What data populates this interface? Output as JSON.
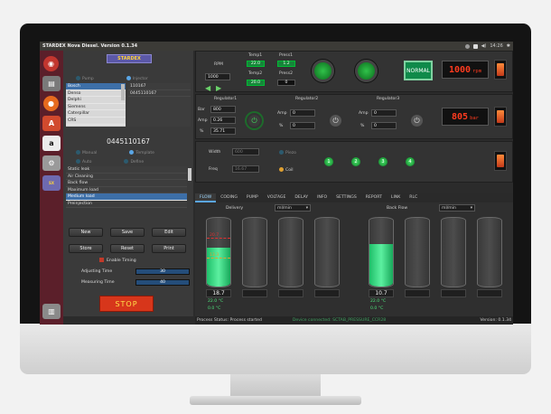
{
  "app": {
    "title": "STARDEX Nova Diesel. Version 0.1.34",
    "clock": "14:26"
  },
  "left": {
    "logo": "STARDEX",
    "radio_top": [
      "Pump",
      "Injector"
    ],
    "brands": [
      "Bosch",
      "Denso",
      "Delphi",
      "Siemens",
      "Caterpillar",
      "CRS"
    ],
    "codes": [
      "110167",
      "0445110167"
    ],
    "selected_code": "0445110167",
    "radio_mid": [
      "Manual",
      "Template"
    ],
    "radio_mid2": [
      "Auto",
      "Define"
    ],
    "tests": [
      "Static leak",
      "Air Cleaning",
      "Back flow",
      "Maximum load",
      "Medium load",
      "Preinjection"
    ],
    "buttons": {
      "new": "New",
      "save": "Save",
      "edit": "Edit",
      "store": "Store",
      "reset": "Reset",
      "print": "Print"
    },
    "enable_timing": "Enable Timing",
    "adjusting_time_label": "Adjusting Time",
    "adjusting_time": "30",
    "measuring_time_label": "Measuring Time",
    "measuring_time": "40",
    "stop": "STOP"
  },
  "top": {
    "rpm_label": "RPM",
    "rpm_value": "1000",
    "temp1_label": "Temp1",
    "temp1_value": "22.0",
    "press1_label": "Press1",
    "press1_value": "1.2",
    "temp2_label": "Temp2",
    "temp2_value": "20.0",
    "press2_label": "Press2",
    "press2_value": "0",
    "normal": "NORMAL",
    "rpm_display": "1000",
    "rpm_unit": "rpm"
  },
  "regulators": {
    "reg1_label": "Regulator1",
    "reg2_label": "Regulator2",
    "reg3_label": "Regulator3",
    "bar_label": "Bar",
    "bar_value": "800",
    "amp_label": "Amp",
    "amp1_value": "0.26",
    "pct_label": "%",
    "pct1_value": "35.71",
    "amp2_value": "0",
    "pct2_value": "0",
    "amp3_value": "0",
    "pct3_value": "0",
    "bar_display": "805",
    "bar_unit": "bar"
  },
  "injection": {
    "width_label": "Width",
    "width_value": "600",
    "freq_label": "Freq",
    "freq_value": "16.67",
    "piezo_label": "Piezo",
    "coil_label": "Coil",
    "channels": [
      "1",
      "2",
      "3",
      "4"
    ]
  },
  "tabs": [
    "FLOW",
    "CODING",
    "PUMP",
    "VOLTAGE",
    "DELAY",
    "INFO",
    "SETTINGS",
    "REPORT",
    "LINK",
    "RLC"
  ],
  "flow": {
    "delivery_label": "Delivery",
    "backflow_label": "Back Flow",
    "unit_left": "ml/min",
    "unit_right": "ml/min",
    "delivery_value": "18.7",
    "delivery_temp1": "22.0 °C",
    "delivery_temp2": "0.0 °C",
    "marker_high": "20.7",
    "marker_low": "13.3",
    "delivery_fill": 0.56,
    "backflow_value": "10.7",
    "backflow_temp1": "22.0 °C",
    "backflow_temp2": "0.0 °C",
    "backflow_fill": 0.62
  },
  "status": {
    "text": "Process Status: Process started",
    "connection": "Device connected: SCTAB_PRESSURE_CCR28",
    "version": "Version: 0.1.34"
  }
}
